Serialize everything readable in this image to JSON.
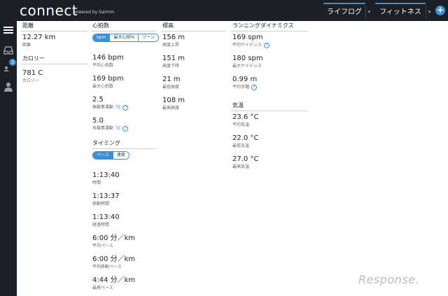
{
  "header": {
    "logo": "connect",
    "logo_sub": "powered by Garmin",
    "tabs": [
      {
        "label": "ライフログ"
      },
      {
        "label": "フィットネス"
      }
    ],
    "add_label": "+"
  },
  "sidebar": {
    "badge_count": "3",
    "icons": [
      "menu-icon",
      "inbox-icon",
      "connections-icon",
      "person-icon"
    ]
  },
  "distance": {
    "heading": "距離",
    "value": "12.27 km",
    "label": "距離"
  },
  "calories": {
    "heading": "カロリー",
    "value": "781 C",
    "label": "カロリー"
  },
  "heart_rate": {
    "heading": "心拍数",
    "segments": [
      "bpm",
      "最大心拍%",
      "ゾーン"
    ],
    "metrics": [
      {
        "value": "146 bpm",
        "label": "平均心拍数"
      },
      {
        "value": "169 bpm",
        "label": "最大心拍数"
      },
      {
        "value": "2.5",
        "label": "無酸素運動",
        "te": "TE"
      },
      {
        "value": "5.0",
        "label": "有酸素運動",
        "te": "TE"
      }
    ]
  },
  "timing": {
    "heading": "タイミング",
    "segments": [
      "ペース",
      "速度"
    ],
    "metrics": [
      {
        "value": "1:13:40",
        "label": "時間"
      },
      {
        "value": "1:13:37",
        "label": "移動時間"
      },
      {
        "value": "1:13:40",
        "label": "経過時間"
      },
      {
        "value": "6:00 分／km",
        "label": "平均ペース"
      },
      {
        "value": "6:00 分／km",
        "label": "平均移動ペース"
      },
      {
        "value": "4:44 分／km",
        "label": "最高ペース"
      }
    ]
  },
  "elevation": {
    "heading": "標高",
    "metrics": [
      {
        "value": "156 m",
        "label": "高度上昇"
      },
      {
        "value": "151 m",
        "label": "高度下降"
      },
      {
        "value": "21 m",
        "label": "最低高度"
      },
      {
        "value": "108 m",
        "label": "最高高度"
      }
    ]
  },
  "running_dynamics": {
    "heading": "ランニングダイナミクス",
    "metrics": [
      {
        "value": "169 spm",
        "label": "平均ケイデンス"
      },
      {
        "value": "180 spm",
        "label": "最大ケイデンス"
      },
      {
        "value": "0.99 m",
        "label": "平均歩幅"
      }
    ]
  },
  "temperature": {
    "heading": "気温",
    "metrics": [
      {
        "value": "23.6 °C",
        "label": "平均気温"
      },
      {
        "value": "22.0 °C",
        "label": "最低気温"
      },
      {
        "value": "27.0 °C",
        "label": "最高気温"
      }
    ]
  },
  "watermark": "Response.",
  "colors": {
    "accent": "#3a8fd6",
    "topbar": "#1c2026"
  }
}
